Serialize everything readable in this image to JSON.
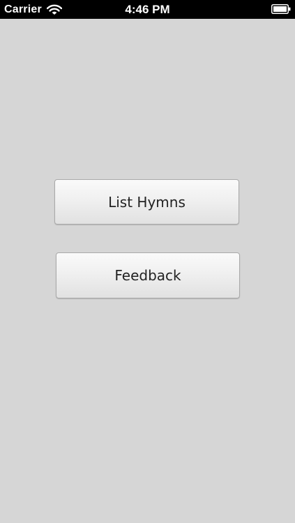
{
  "status_bar": {
    "carrier": "Carrier",
    "time": "4:46 PM",
    "wifi_icon": "wifi-icon",
    "battery_icon": "battery-icon"
  },
  "main": {
    "buttons": [
      {
        "label": "List Hymns"
      },
      {
        "label": "Feedback"
      }
    ]
  },
  "colors": {
    "background": "#d6d6d6",
    "status_bar": "#000000",
    "button_text": "#222222"
  }
}
